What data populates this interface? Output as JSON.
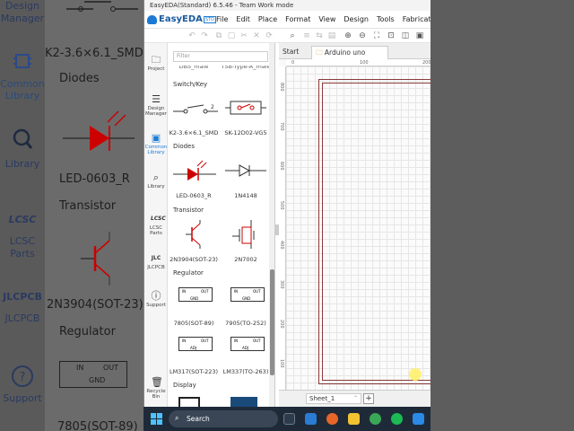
{
  "window": {
    "title": "EasyEDA(Standard) 6.5.46 - Team Work mode"
  },
  "logo": {
    "name": "EasyEDA",
    "edition": "STD"
  },
  "menu": [
    "File",
    "Edit",
    "Place",
    "Format",
    "View",
    "Design",
    "Tools",
    "Fabrication"
  ],
  "nav": [
    {
      "label": "Project",
      "icon": "folder-icon"
    },
    {
      "label": "Design Manager",
      "icon": "list-icon"
    },
    {
      "label": "Common Library",
      "icon": "chip-icon"
    },
    {
      "label": "Library",
      "icon": "search-icon"
    },
    {
      "label": "LCSC Parts",
      "icon": "lcsc-icon"
    },
    {
      "label": "JLCPCB",
      "icon": "jlc-icon"
    },
    {
      "label": "Support",
      "icon": "help-icon"
    },
    {
      "label": "Recycle Bin",
      "icon": "trash-icon"
    }
  ],
  "panel": {
    "filter_placeholder": "Filter",
    "top_cutoff": [
      "DBS_male",
      "TSB-Type-A_male"
    ],
    "categories": {
      "switch": "Switch/Key",
      "diodes": "Diodes",
      "transistor": "Transistor",
      "regulator": "Regulator",
      "display": "Display"
    },
    "components": {
      "switch": [
        "K2-3.6×6.1_SMD",
        "SK-12D02-VG5"
      ],
      "diodes": [
        "LED-0603_R",
        "1N4148"
      ],
      "transistor": [
        "2N3904(SOT-23)",
        "2N7002"
      ],
      "regulator1": [
        "7805(SOT-89)",
        "7905(TO-252)"
      ],
      "regulator2": [
        "LM317(SOT-223)",
        "LM337(TO-263)"
      ]
    },
    "pin_labels": {
      "in": "IN",
      "out": "OUT",
      "gnd": "GND",
      "adj": "ADJ"
    }
  },
  "tabs": [
    {
      "label": "Start"
    },
    {
      "label": "Arduino uno"
    }
  ],
  "ruler": {
    "top": [
      "0",
      "100",
      "200"
    ],
    "left": [
      "800",
      "700",
      "600",
      "500",
      "400",
      "300",
      "200",
      "100"
    ]
  },
  "sheet": {
    "tab": "Sheet_1",
    "add": "+"
  },
  "taskbar": {
    "search_label": "Search"
  },
  "backdrop": {
    "design": "Design",
    "manager": "Manager",
    "common": "Common",
    "library": "Library",
    "library2": "Library",
    "lcsc": "LCSC",
    "parts": "Parts",
    "jlcpcb": "JLCPCB",
    "support": "Support",
    "diodes": "Diodes",
    "led": "LED-0603_R",
    "transistor": "Transistor",
    "npn": "2N3904(SOT-23)",
    "regulator": "Regulator",
    "k2": "K2-3.6×6.1_SMD",
    "reg_in": "IN",
    "reg_out": "OUT",
    "reg_gnd": "GND",
    "bottom": "7805(SOT-89)"
  },
  "colors": {
    "accent": "#1a7ad4",
    "sheet_border": "#8b3a3a",
    "taskbar": "#1f2a38"
  }
}
